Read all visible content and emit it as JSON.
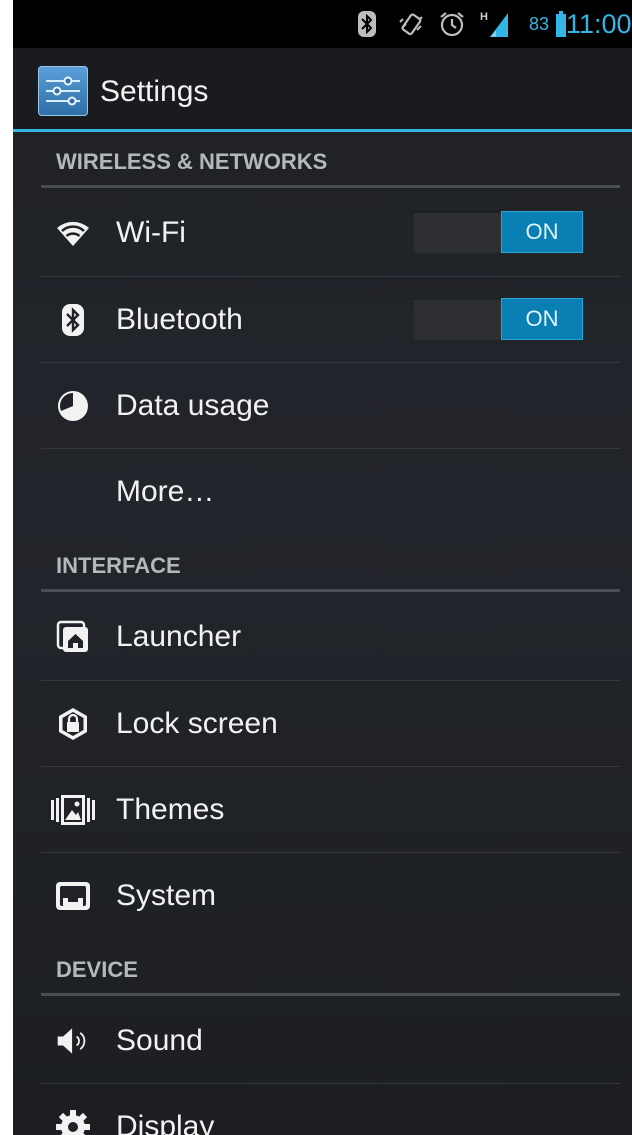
{
  "status_bar": {
    "battery_percent": "83",
    "clock": "11:00",
    "icons": [
      "bluetooth-icon",
      "vibrate-icon",
      "alarm-icon",
      "signal-hspa-icon",
      "battery-icon"
    ]
  },
  "action_bar": {
    "title": "Settings",
    "icon": "settings-sliders-icon"
  },
  "sections": {
    "wireless": {
      "header": "WIRELESS & NETWORKS",
      "wifi": {
        "label": "Wi-Fi",
        "toggle": "ON",
        "icon": "wifi-icon"
      },
      "bluetooth": {
        "label": "Bluetooth",
        "toggle": "ON",
        "icon": "bluetooth-icon"
      },
      "data_usage": {
        "label": "Data usage",
        "icon": "data-usage-icon"
      },
      "more": {
        "label": "More…"
      }
    },
    "interface": {
      "header": "INTERFACE",
      "launcher": {
        "label": "Launcher",
        "icon": "launcher-icon"
      },
      "lock_screen": {
        "label": "Lock screen",
        "icon": "lock-icon"
      },
      "themes": {
        "label": "Themes",
        "icon": "themes-icon"
      },
      "system": {
        "label": "System",
        "icon": "system-icon"
      }
    },
    "device": {
      "header": "DEVICE",
      "sound": {
        "label": "Sound",
        "icon": "sound-icon"
      },
      "display": {
        "label": "Display",
        "icon": "display-gear-icon"
      }
    }
  },
  "colors": {
    "accent": "#33b5e5",
    "toggle_on": "#0a7fb4",
    "background": "#1f2126",
    "text": "#f2f2f2",
    "section_text": "#b4b8bc"
  }
}
